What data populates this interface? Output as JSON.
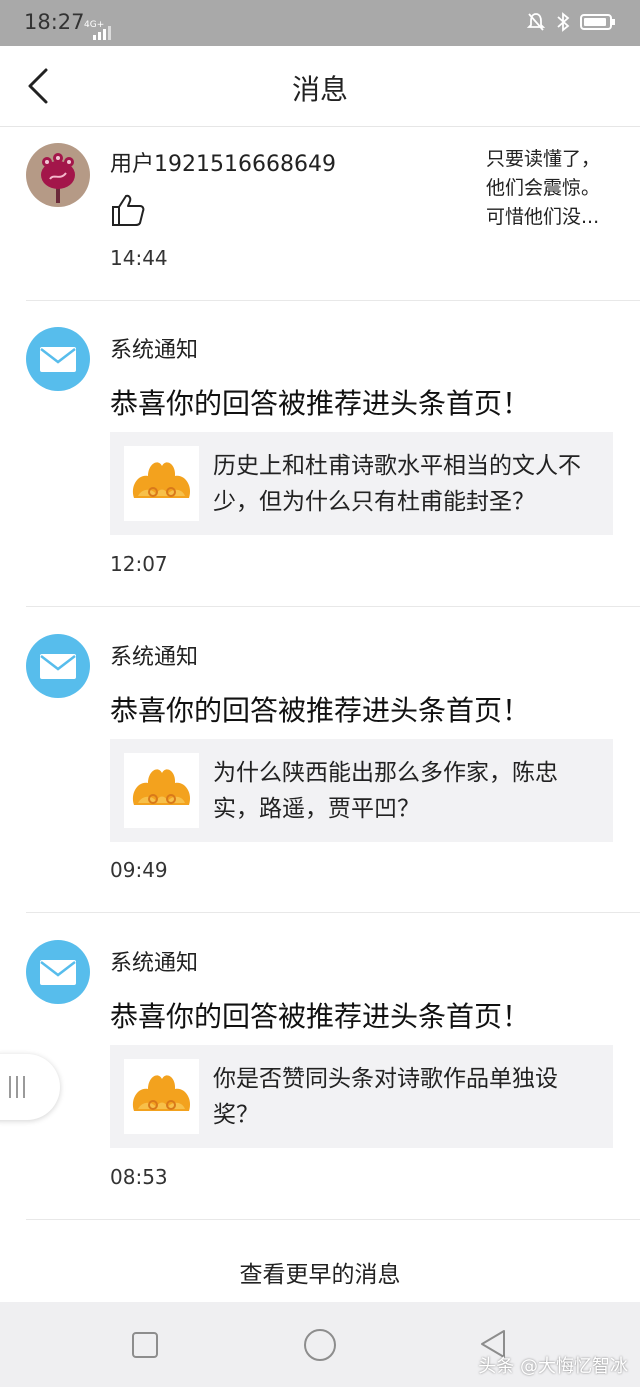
{
  "status_bar": {
    "time": "18:27",
    "network": "4G+"
  },
  "nav": {
    "title": "消息"
  },
  "messages": [
    {
      "type": "user_like",
      "sender": "用户1921516668649",
      "excerpt": "只要读懂了，他们会震惊。可惜他们没...",
      "time": "14:44"
    },
    {
      "type": "system",
      "sender": "系统通知",
      "headline": "恭喜你的回答被推荐进头条首页！",
      "question": "历史上和杜甫诗歌水平相当的文人不少，但为什么只有杜甫能封圣？",
      "time": "12:07"
    },
    {
      "type": "system",
      "sender": "系统通知",
      "headline": "恭喜你的回答被推荐进头条首页！",
      "question": "为什么陕西能出那么多作家，陈忠实，路遥，贾平凹？",
      "time": "09:49"
    },
    {
      "type": "system",
      "sender": "系统通知",
      "headline": "恭喜你的回答被推荐进头条首页！",
      "question": "你是否赞同头条对诗歌作品单独设奖？",
      "time": "08:53"
    }
  ],
  "more_label": "查看更早的消息",
  "watermark": "头条 @大悔忆智冰"
}
